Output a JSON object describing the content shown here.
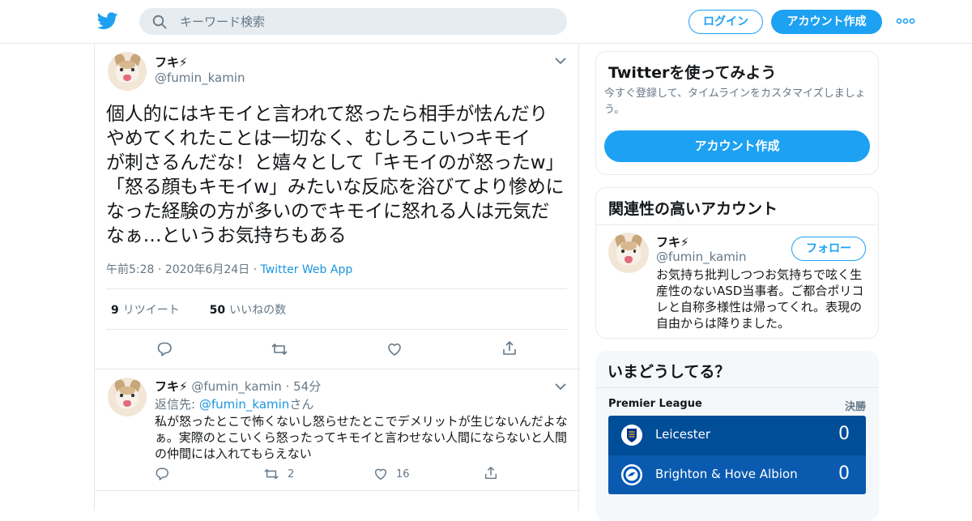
{
  "header": {
    "search_placeholder": "キーワード検索",
    "login_label": "ログイン",
    "signup_label": "アカウント作成"
  },
  "tweet": {
    "name": "フキ⚡",
    "handle": "@fumin_kamin",
    "text": "個人的にはキモイと言われて怒ったら相手が怯んだり\nやめてくれたことは一切なく、むしろこいつキモイ\nが刺さるんだな！と嬉々として「キモイのが怒ったw」\n「怒る顔もキモイw」みたいな反応を浴びてより惨めに\nなった経験の方が多いのでキモイに怒れる人は元気だ\nなぁ…というお気持ちもある",
    "time": "午前5:28",
    "date": "2020年6月24日",
    "source": "Twitter Web App",
    "retweet_count": "9",
    "retweet_label": "リツイート",
    "like_count": "50",
    "like_label": "いいねの数"
  },
  "reply": {
    "name": "フキ⚡",
    "handle": "@fumin_kamin",
    "age": "54分",
    "reply_to_prefix": "返信先: ",
    "reply_to_handle": "@fumin_kamin",
    "reply_to_suffix": "さん",
    "text": "私が怒ったとこで怖くないし怒らせたとこでデメリットが生じないんだよなぁ。実際のとこいくら怒ったってキモイと言わせない人間にならないと人間の仲間には入れてもらえない",
    "retweets": "2",
    "likes": "16"
  },
  "signup_card": {
    "title": "Twitterを使ってみよう",
    "subtitle": "今すぐ登録して、タイムラインをカスタマイズしましょう。",
    "button": "アカウント作成"
  },
  "related_card": {
    "title": "関連性の高いアカウント",
    "name": "フキ⚡",
    "handle": "@fumin_kamin",
    "follow": "フォロー",
    "bio": "お気持ち批判しつつお気持ちで呟く生産性のないASD当事者。ご都合ポリコレと自称多様性は帰ってくれ。表現の自由からは降りました。"
  },
  "trends": {
    "title": "いまどうしてる？",
    "league": "Premier League",
    "status": "決勝",
    "home_team": "Leicester",
    "home_score": "0",
    "away_team": "Brighton & Hove Albion",
    "away_score": "0"
  },
  "colors": {
    "brand": "#1da1f2",
    "link": "#1b95e0",
    "secondary_text": "#657786",
    "score_bg": "#004d98"
  }
}
